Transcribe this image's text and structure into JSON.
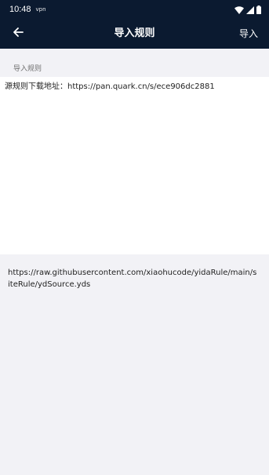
{
  "status_bar": {
    "time": "10:48",
    "notification": "vpn",
    "icons": [
      "wifi-icon",
      "signal-icon",
      "battery-icon"
    ]
  },
  "app_bar": {
    "title": "导入规则",
    "action_label": "导入",
    "back_icon": "arrow-left-icon"
  },
  "section": {
    "label": "导入规则"
  },
  "input": {
    "value": "源规则下载地址：https://pan.quark.cn/s/ece906dc2881"
  },
  "hint": {
    "url": "https://raw.githubusercontent.com/xiaohucode/yidaRule/main/siteRule/ydSource.yds"
  },
  "colors": {
    "app_bar": "#0b1a30",
    "background": "#f2f2f6",
    "field": "#ffffff"
  }
}
